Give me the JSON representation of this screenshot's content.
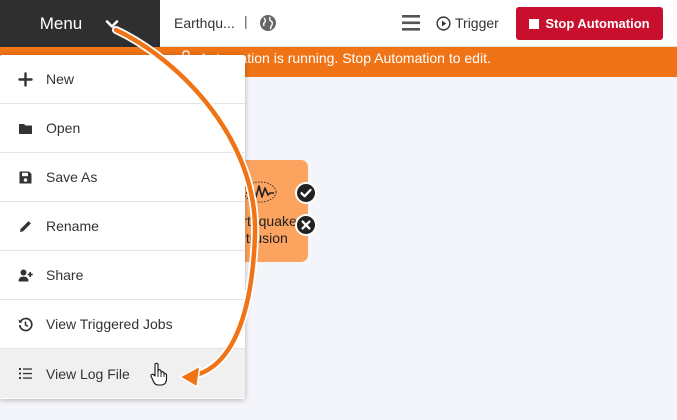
{
  "topbar": {
    "menu_label": "Menu",
    "workflow_name": "Earthqu...",
    "separator": "|",
    "trigger_label": "Trigger",
    "stop_label": "Stop Automation"
  },
  "banner": {
    "text": "Automation is running. Stop Automation to edit."
  },
  "node": {
    "label_line1": "Earthquake",
    "label_line2": "Intrusion"
  },
  "menu": {
    "items": [
      {
        "label": "New",
        "icon": "plus-icon"
      },
      {
        "label": "Open",
        "icon": "folder-icon"
      },
      {
        "label": "Save As",
        "icon": "save-icon"
      },
      {
        "label": "Rename",
        "icon": "pencil-icon"
      },
      {
        "label": "Share",
        "icon": "user-plus-icon"
      },
      {
        "label": "View Triggered Jobs",
        "icon": "history-icon"
      },
      {
        "label": "View Log File",
        "icon": "list-icon"
      }
    ]
  },
  "colors": {
    "menu_bar": "#2f2f2f",
    "stop_button": "#c8102e",
    "banner": "#f07416",
    "node": "#fba35f",
    "arrow": "#f07416"
  }
}
